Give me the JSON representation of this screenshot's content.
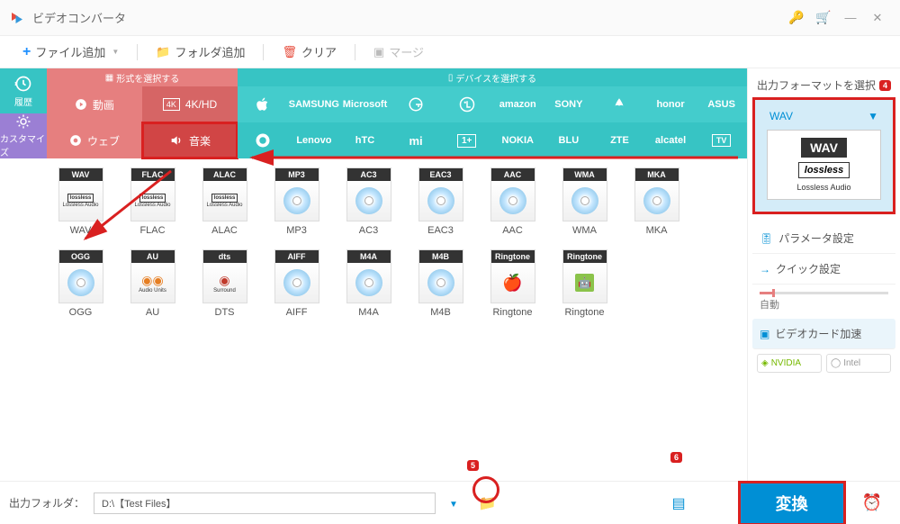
{
  "app_title": "ビデオコンバータ",
  "toolbar": {
    "add_file": "ファイル追加",
    "add_folder": "フォルダ追加",
    "clear": "クリア",
    "merge": "マージ"
  },
  "rail": {
    "history": "履歴",
    "customize": "カスタマイズ"
  },
  "sections": {
    "format_header": "形式を選択する",
    "device_header": "デバイスを選択する"
  },
  "format_tabs": {
    "video": "動画",
    "hd": "4K/HD",
    "web": "ウェブ",
    "music": "音楽"
  },
  "brands_row1": [
    "",
    "SAMSUNG",
    "Microsoft",
    "G",
    "LG",
    "amazon",
    "SONY",
    "HUAWEI",
    "honor",
    "ASUS"
  ],
  "brands_row2": [
    "",
    "Lenovo",
    "hTC",
    "mi",
    "1+",
    "NOKIA",
    "BLU",
    "ZTE",
    "alcatel",
    "TV"
  ],
  "formats": [
    {
      "badge": "WAV",
      "sub": "Lossless Audio",
      "label": "WAV",
      "type": "lossless"
    },
    {
      "badge": "FLAC",
      "sub": "Lossless Audio",
      "label": "FLAC",
      "type": "lossless"
    },
    {
      "badge": "ALAC",
      "sub": "Lossless Audio",
      "label": "ALAC",
      "type": "lossless"
    },
    {
      "badge": "MP3",
      "sub": "",
      "label": "MP3",
      "type": "disc"
    },
    {
      "badge": "AC3",
      "sub": "",
      "label": "AC3",
      "type": "disc"
    },
    {
      "badge": "EAC3",
      "sub": "",
      "label": "EAC3",
      "type": "disc"
    },
    {
      "badge": "AAC",
      "sub": "",
      "label": "AAC",
      "type": "disc"
    },
    {
      "badge": "WMA",
      "sub": "",
      "label": "WMA",
      "type": "disc"
    },
    {
      "badge": "MKA",
      "sub": "",
      "label": "MKA",
      "type": "disc"
    },
    {
      "badge": "OGG",
      "sub": "",
      "label": "OGG",
      "type": "disc"
    },
    {
      "badge": "AU",
      "sub": "Audio Units",
      "label": "AU",
      "type": "text"
    },
    {
      "badge": "dts",
      "sub": "Surround",
      "label": "DTS",
      "type": "text"
    },
    {
      "badge": "AIFF",
      "sub": "",
      "label": "AIFF",
      "type": "disc"
    },
    {
      "badge": "M4A",
      "sub": "",
      "label": "M4A",
      "type": "disc"
    },
    {
      "badge": "M4B",
      "sub": "",
      "label": "M4B",
      "type": "disc"
    },
    {
      "badge": "Ringtone",
      "sub": "",
      "label": "Ringtone",
      "type": "apple"
    },
    {
      "badge": "Ringtone",
      "sub": "",
      "label": "Ringtone",
      "type": "android"
    }
  ],
  "right": {
    "select_format": "出力フォーマットを選択",
    "preview_format": "WAV",
    "preview_badge": "WAV",
    "preview_sub_brand": "lossless",
    "preview_sub": "Lossless Audio",
    "params": "パラメータ設定",
    "quick": "クイック設定",
    "auto": "自動",
    "gpu_accel": "ビデオカード加速",
    "nvidia": "NVIDIA",
    "intel": "Intel"
  },
  "bottom": {
    "out_label": "出力フォルダ：",
    "out_path": "D:\\【Test Files】",
    "convert": "変換"
  },
  "badges": {
    "b4": "4",
    "b5": "5",
    "b6": "6"
  }
}
